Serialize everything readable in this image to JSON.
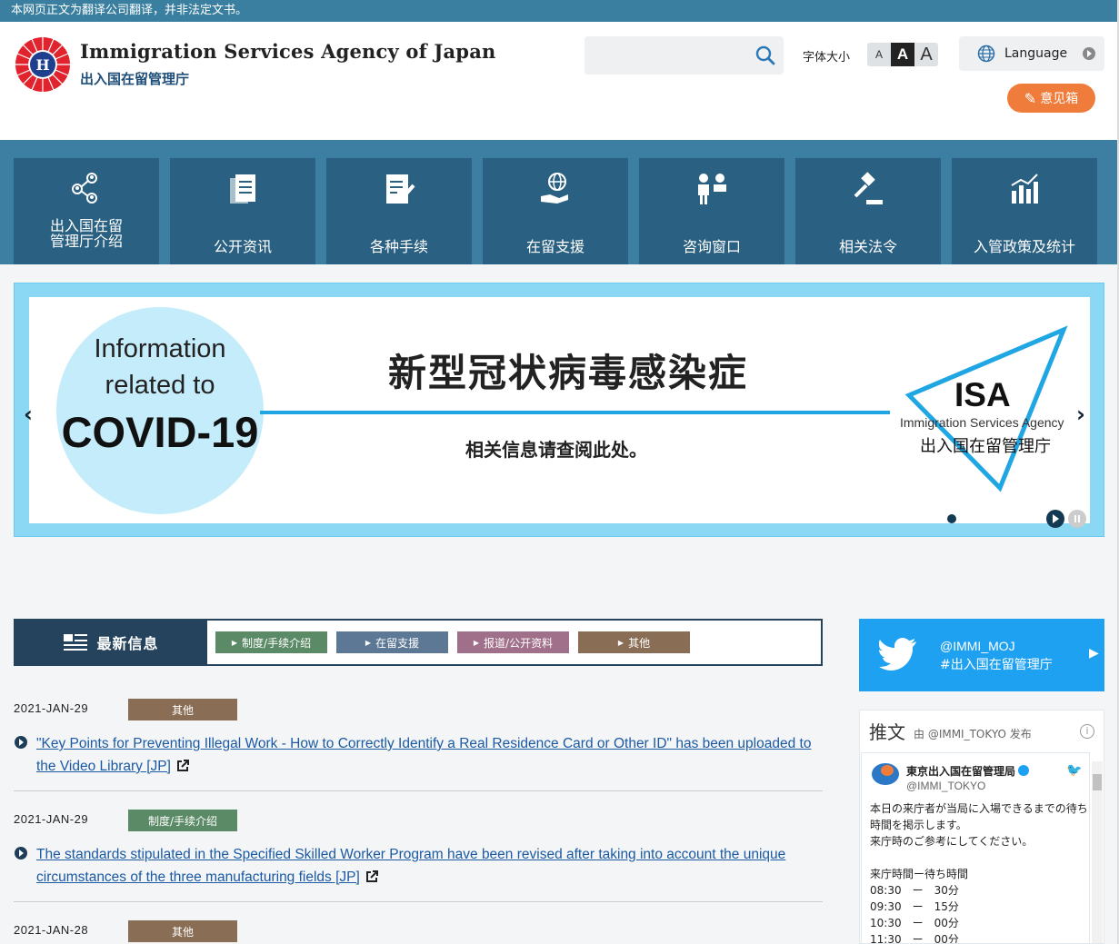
{
  "notice": "本网页正文为翻译公司翻译，并非法定文书。",
  "header": {
    "logo_en": "Immigration Services Agency of Japan",
    "logo_zh": "出入国在留管理庁",
    "search_placeholder": "",
    "fontsize_label": "字体大小",
    "fontsize_buttons": [
      "A",
      "A",
      "A"
    ],
    "language_label": "Language",
    "opinion_label": "意见箱"
  },
  "nav": {
    "items": [
      {
        "label_1": "出入国在留",
        "label_2": "管理厅介绍"
      },
      {
        "label": "公开资讯"
      },
      {
        "label": "各种手续"
      },
      {
        "label": "在留支援"
      },
      {
        "label": "咨询窗口"
      },
      {
        "label": "相关法令"
      },
      {
        "label": "入管政策及统计"
      }
    ]
  },
  "carousel": {
    "circle_line1": "Information",
    "circle_line2": "related to",
    "circle_line3": "COVID-19",
    "title": "新型冠状病毒感染症",
    "subtitle": "相关信息请查阅此处。",
    "isa_title": "ISA",
    "isa_en": "Immigration Services Agency",
    "isa_zh": "出入国在留管理庁",
    "prev_glyph": "‹",
    "next_glyph": "›"
  },
  "news": {
    "title": "最新信息",
    "categories": [
      {
        "label": "制度/手续介绍",
        "color": "#5b8a66"
      },
      {
        "label": "在留支援",
        "color": "#5d7895"
      },
      {
        "label": "报道/公开资料",
        "color": "#a0708a"
      },
      {
        "label": "其他",
        "color": "#8a6d55"
      }
    ],
    "items": [
      {
        "date": "2021-JAN-29",
        "badge": "其他",
        "badge_color": "#8a6d55",
        "text": "\"Key Points for Preventing Illegal Work - How to Correctly Identify a Real Residence Card or Other ID\" has been uploaded to the Video Library [JP]"
      },
      {
        "date": "2021-JAN-29",
        "badge": "制度/手续介绍",
        "badge_color": "#5b8a66",
        "text": "The standards stipulated in the Specified Skilled Worker Program have been revised after taking into account the unique circumstances of the three manufacturing fields [JP]"
      },
      {
        "date": "2021-JAN-28",
        "badge": "其他",
        "badge_color": "#8a6d55",
        "text": ""
      }
    ]
  },
  "twitter": {
    "handle": "@IMMI_MOJ",
    "tag": "#出入国在留管理庁",
    "timeline_head": "推文",
    "timeline_by": "由 @IMMI_TOKYO 发布",
    "info_glyph": "i",
    "tweet_name": "東京出入国在留管理局",
    "tweet_handle": "@IMMI_TOKYO",
    "tweet_text": "本日の来庁者が当局に入場できるまでの待ち時間を掲示します。\n来庁時のご参考にしてください。\n\n来庁時間ー待ち時間\n08:30　ー　30分\n09:30　ー　15分\n10:30　ー　00分\n11:30　ー　00分"
  }
}
